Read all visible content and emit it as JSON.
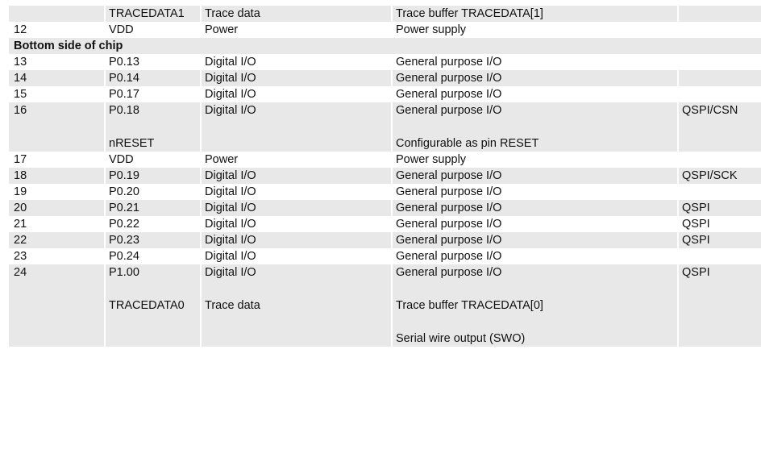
{
  "rows": [
    {
      "pin": "",
      "name": "TRACEDATA1",
      "type": "Trace data",
      "desc": "Trace buffer TRACEDATA[1]",
      "extra": ""
    },
    {
      "pin": "12",
      "name": "VDD",
      "type": "Power",
      "desc": "Power supply",
      "extra": ""
    },
    {
      "section": "Bottom side of chip"
    },
    {
      "pin": "13",
      "name": "P0.13",
      "type": "Digital I/O",
      "desc": "General purpose I/O",
      "extra": ""
    },
    {
      "pin": "14",
      "name": "P0.14",
      "type": "Digital I/O",
      "desc": "General purpose I/O",
      "extra": ""
    },
    {
      "pin": "15",
      "name": "P0.17",
      "type": "Digital I/O",
      "desc": "General purpose I/O",
      "extra": ""
    },
    {
      "pin": "16",
      "name": "P0.18",
      "type": "Digital I/O",
      "desc": "General purpose I/O",
      "extra": "QSPI/CSN",
      "name2": "nRESET",
      "desc2": "Configurable as pin RESET"
    },
    {
      "pin": "17",
      "name": "VDD",
      "type": "Power",
      "desc": "Power supply",
      "extra": ""
    },
    {
      "pin": "18",
      "name": "P0.19",
      "type": "Digital I/O",
      "desc": "General purpose I/O",
      "extra": "QSPI/SCK"
    },
    {
      "pin": "19",
      "name": "P0.20",
      "type": "Digital I/O",
      "desc": "General purpose I/O",
      "extra": ""
    },
    {
      "pin": "20",
      "name": "P0.21",
      "type": "Digital I/O",
      "desc": "General purpose I/O",
      "extra": "QSPI"
    },
    {
      "pin": "21",
      "name": "P0.22",
      "type": "Digital I/O",
      "desc": "General purpose I/O",
      "extra": "QSPI"
    },
    {
      "pin": "22",
      "name": "P0.23",
      "type": "Digital I/O",
      "desc": "General purpose I/O",
      "extra": "QSPI"
    },
    {
      "pin": "23",
      "name": "P0.24",
      "type": "Digital I/O",
      "desc": "General purpose I/O",
      "extra": ""
    },
    {
      "pin": "24",
      "name": "P1.00",
      "type": "Digital I/O",
      "desc": "General purpose I/O",
      "extra": "QSPI",
      "name2": "TRACEDATA0",
      "type2": "Trace data",
      "desc2": "Trace buffer TRACEDATA[0]",
      "desc3": "Serial wire output (SWO)"
    }
  ]
}
